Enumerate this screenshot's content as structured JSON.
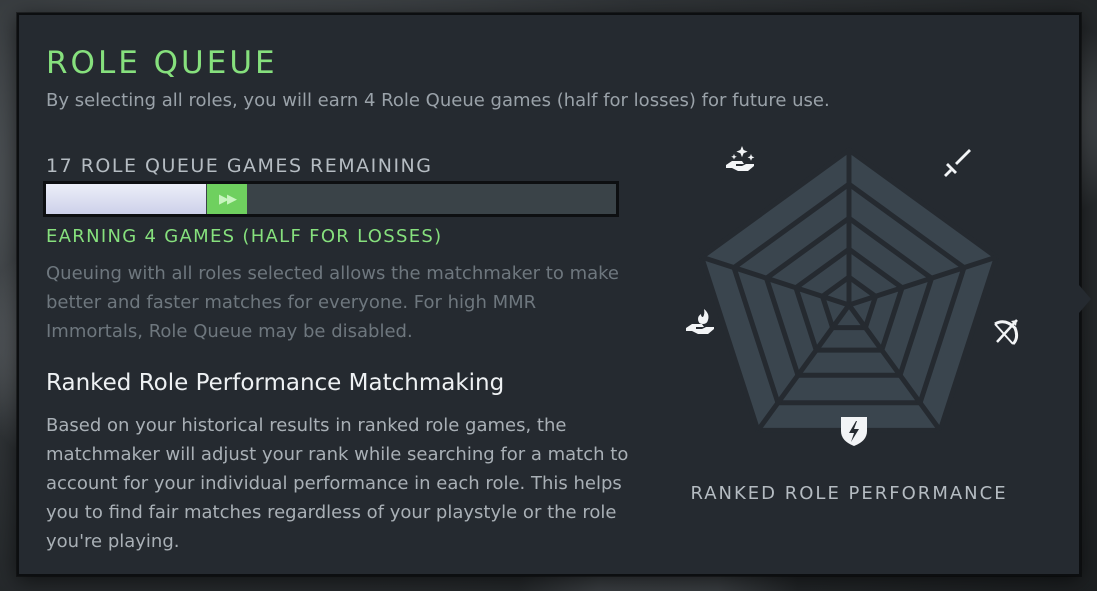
{
  "panel": {
    "title": "ROLE QUEUE",
    "subtitle": "By selecting all roles, you will earn 4 Role Queue games (half for losses) for future use."
  },
  "queue": {
    "remaining_label": "17 ROLE QUEUE GAMES REMAINING",
    "remaining_count": 17,
    "progress_fraction": 0.28,
    "earn_indicator": "▶▶",
    "earning_label": "EARNING 4 GAMES (HALF FOR LOSSES)",
    "description": "Queuing with all roles selected allows the matchmaker to make better and faster matches for everyone. For high MMR Immortals, Role Queue may be disabled."
  },
  "performance": {
    "heading": "Ranked Role Performance Matchmaking",
    "description": "Based on your historical results in ranked role games, the matchmaker will adjust your rank while searching for a match to account for your individual performance in each role. This helps you to find fair matches regardless of your playstyle or the role you're playing.",
    "radar_label": "RANKED ROLE PERFORMANCE",
    "roles": [
      {
        "name": "carry",
        "icon": "sword-icon"
      },
      {
        "name": "offlane",
        "icon": "bow-icon"
      },
      {
        "name": "mid",
        "icon": "lightning-shield-icon"
      },
      {
        "name": "soft-support",
        "icon": "flame-hand-icon"
      },
      {
        "name": "hard-support",
        "icon": "sparkle-hand-icon"
      }
    ]
  },
  "colors": {
    "accent_green": "#86e07d",
    "panel_bg": "#252a30",
    "radar_fill": "#3a454e"
  }
}
